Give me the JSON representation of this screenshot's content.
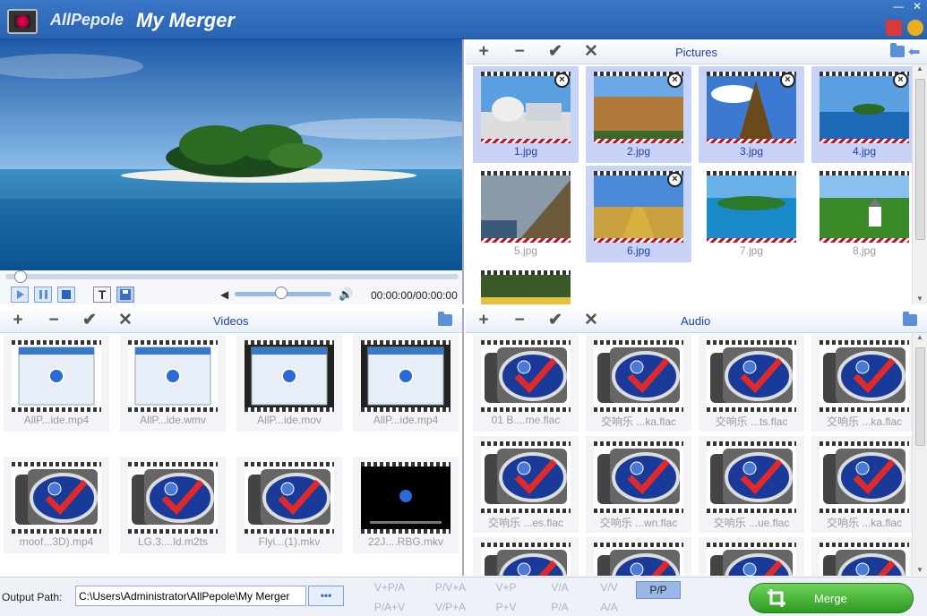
{
  "titlebar": {
    "brand": "AllPepole",
    "app": "My Merger"
  },
  "player": {
    "time": "00:00:00/00:00:00",
    "volume_pct": 0.48
  },
  "pictures": {
    "title": "Pictures",
    "items": [
      {
        "cap": "1.jpg",
        "sel": true,
        "x": 0
      },
      {
        "cap": "2.jpg",
        "sel": true,
        "x": 1
      },
      {
        "cap": "3.jpg",
        "sel": true,
        "x": 2
      },
      {
        "cap": "4.jpg",
        "sel": true,
        "x": 3
      },
      {
        "cap": "5.jpg",
        "sel": false,
        "x": 4
      },
      {
        "cap": "6.jpg",
        "sel": true,
        "x": 5
      },
      {
        "cap": "7.jpg",
        "sel": false,
        "x": 6
      },
      {
        "cap": "8.jpg",
        "sel": false,
        "x": 7
      },
      {
        "cap": "",
        "sel": false,
        "x": 8
      }
    ]
  },
  "videos": {
    "title": "Videos",
    "items": [
      {
        "cap": "AllP...ide.mp4",
        "kind": "shot"
      },
      {
        "cap": "AllP...ide.wmv",
        "kind": "shot"
      },
      {
        "cap": "AllP...ide.mov",
        "kind": "shot2"
      },
      {
        "cap": "AllP...ide.mp4",
        "kind": "shot2"
      },
      {
        "cap": "moof...3D).mp4",
        "kind": "logo"
      },
      {
        "cap": "LG.3....ld.m2ts",
        "kind": "logo"
      },
      {
        "cap": "Flyi...(1).mkv",
        "kind": "logo"
      },
      {
        "cap": "22J....RBG.mkv",
        "kind": "black"
      }
    ]
  },
  "audio": {
    "title": "Audio",
    "items": [
      "01 B....me.flac",
      "交响乐 ...ka.flac",
      "交响乐 ...ts.flac",
      "交响乐 ...ka.flac",
      "交响乐 ...es.flac",
      "交响乐 ...wn.flac",
      "交响乐 ...ue.flac",
      "交响乐 ...ka.flac",
      "",
      "",
      "",
      ""
    ]
  },
  "bottom": {
    "output_label": "Output Path:",
    "output_value": "C:\\Users\\Administrator\\AllPepole\\My Merger",
    "browse": "•••",
    "merge": "Merge",
    "modes_top": [
      "V+P/A",
      "P/V+A",
      "V+P",
      "V/A",
      "V/V",
      "P/P"
    ],
    "modes_bottom": [
      "P/A+V",
      "V/P+A",
      "P+V",
      "P/A",
      "A/A"
    ],
    "active_mode": "P/P"
  }
}
